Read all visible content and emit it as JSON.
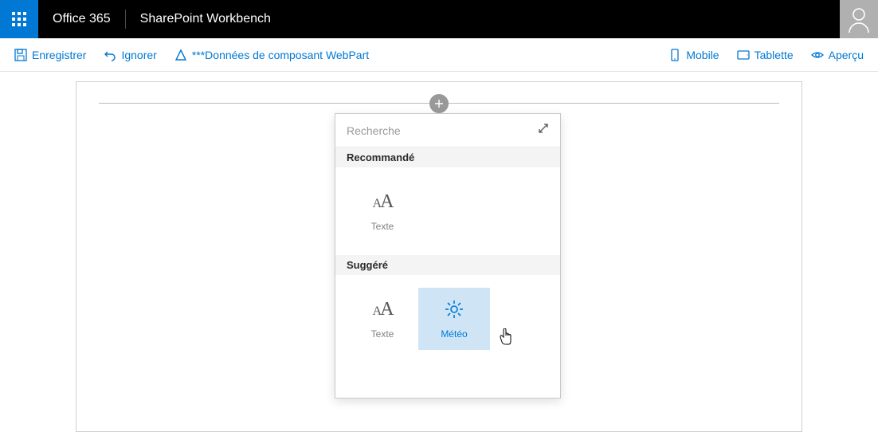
{
  "header": {
    "brand": "Office 365",
    "app": "SharePoint Workbench"
  },
  "commandBar": {
    "save": "Enregistrer",
    "discard": "Ignorer",
    "webpartData": "***Données de composant WebPart",
    "mobile": "Mobile",
    "tablet": "Tablette",
    "preview": "Aperçu"
  },
  "picker": {
    "searchPlaceholder": "Recherche",
    "sections": {
      "recommended": {
        "title": "Recommandé",
        "items": [
          {
            "label": "Texte",
            "icon": "text"
          }
        ]
      },
      "suggested": {
        "title": "Suggéré",
        "items": [
          {
            "label": "Texte",
            "icon": "text"
          },
          {
            "label": "Météo",
            "icon": "weather"
          }
        ]
      }
    }
  }
}
